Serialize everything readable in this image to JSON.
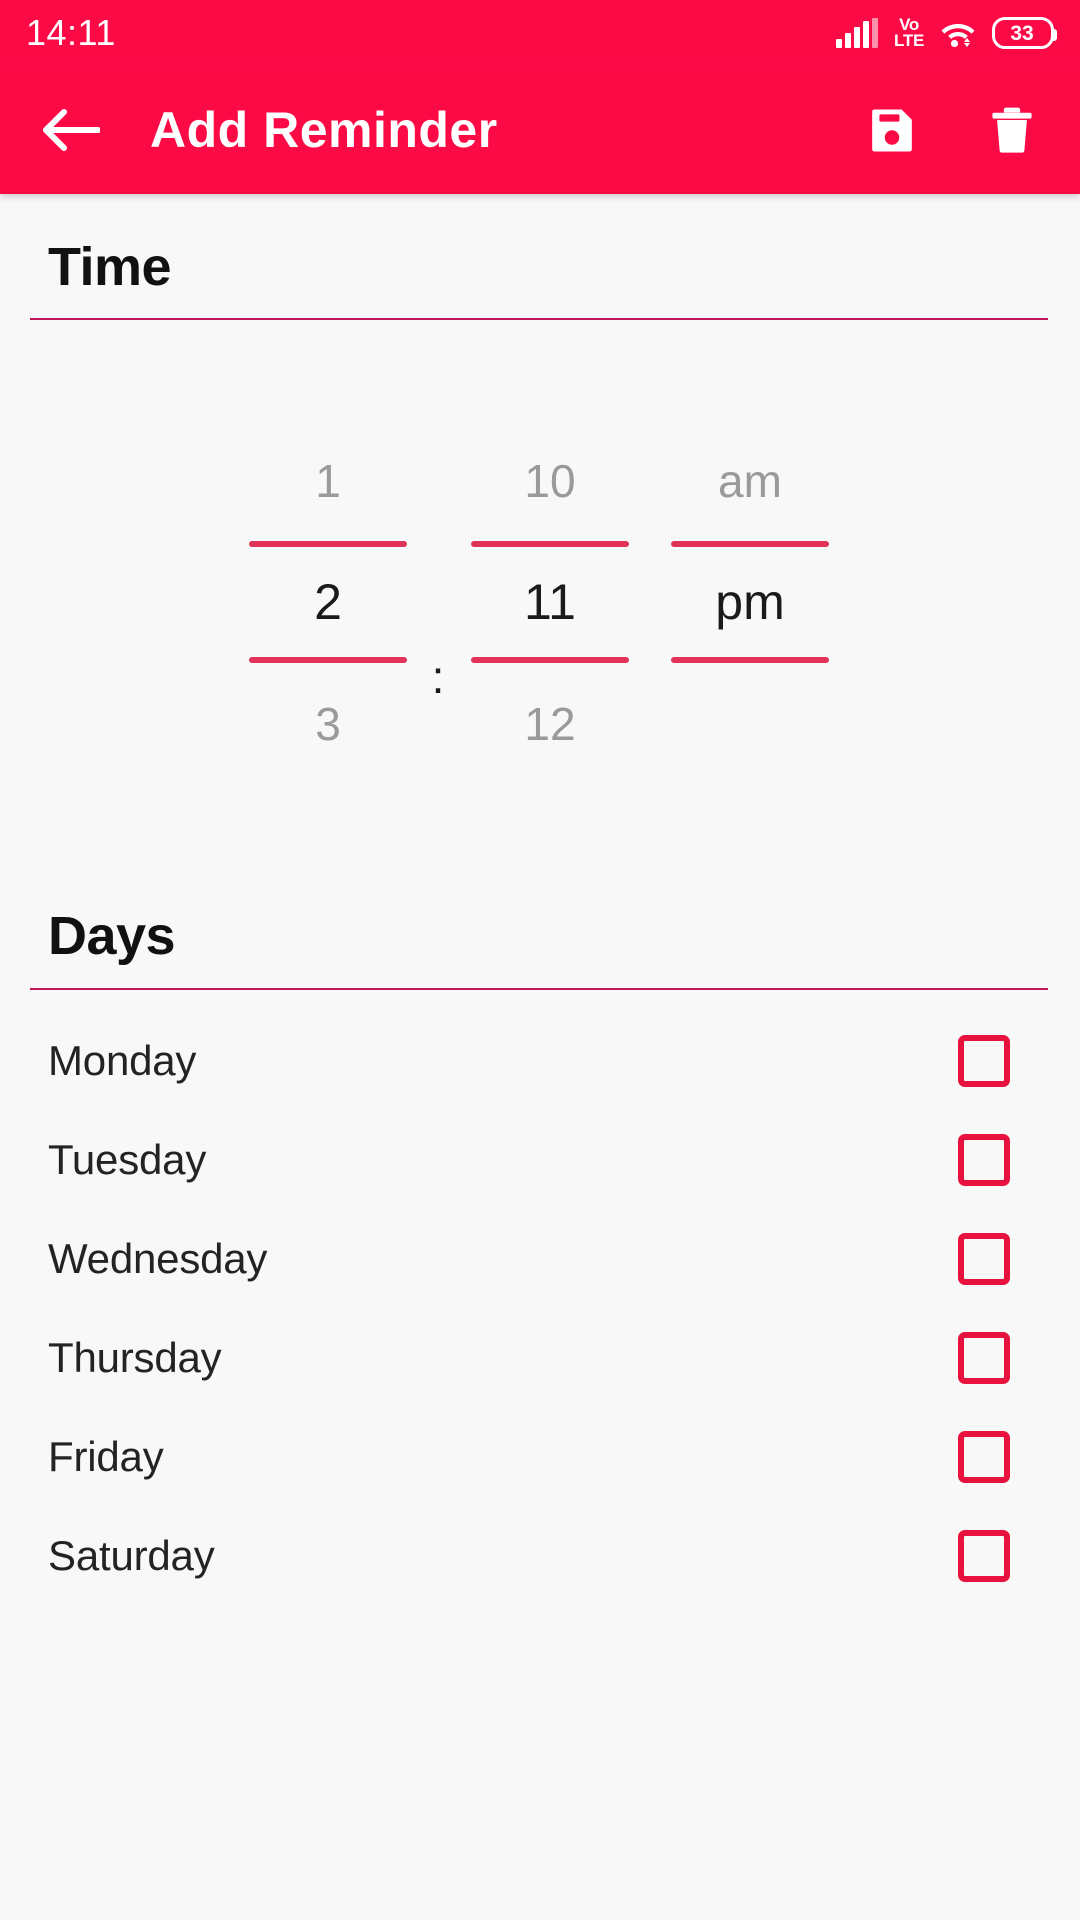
{
  "theme": {
    "primary": "#FB0A46",
    "accent": "#E1325A",
    "rule": "#C2185B",
    "checkbox_border": "#E8123F",
    "background": "#F8F8F8",
    "text_primary": "#1A1A1A",
    "text_muted": "#9A9A9A"
  },
  "status_bar": {
    "clock": "14:11",
    "network_type": "VoLTE",
    "volte_line1": "Vo",
    "volte_line2": "LTE",
    "battery_percent": "33",
    "icons": [
      "signal-bars-icon",
      "volte-icon",
      "wifi-icon",
      "battery-icon"
    ]
  },
  "app_bar": {
    "back_icon": "arrow-left-icon",
    "title": "Add Reminder",
    "save_icon": "save-floppy-icon",
    "delete_icon": "trash-icon"
  },
  "time_section": {
    "header": "Time",
    "separator": ":",
    "hour": {
      "previous": "1",
      "current": "2",
      "next": "3"
    },
    "minute": {
      "previous": "10",
      "current": "11",
      "next": "12"
    },
    "meridiem": {
      "previous": "am",
      "current": "pm",
      "next": ""
    }
  },
  "days_section": {
    "header": "Days",
    "items": [
      {
        "label": "Monday",
        "checked": false
      },
      {
        "label": "Tuesday",
        "checked": false
      },
      {
        "label": "Wednesday",
        "checked": false
      },
      {
        "label": "Thursday",
        "checked": false
      },
      {
        "label": "Friday",
        "checked": false
      },
      {
        "label": "Saturday",
        "checked": false
      }
    ]
  }
}
